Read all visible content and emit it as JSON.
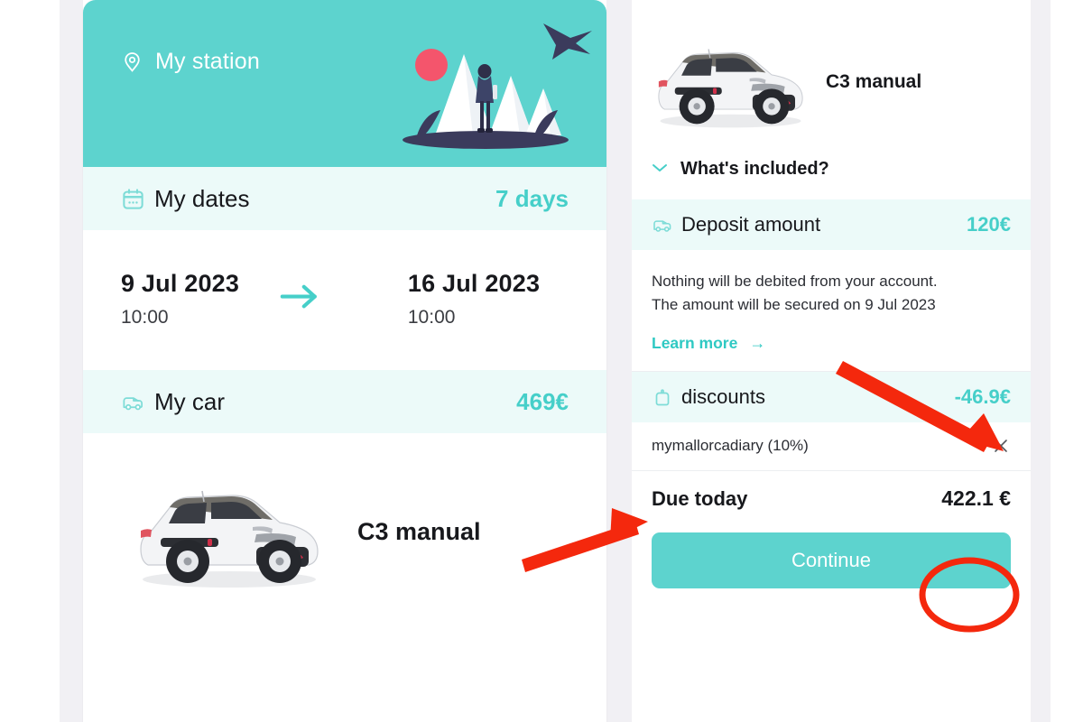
{
  "colors": {
    "teal": "#5dd3ce",
    "teal_text": "#46cfc9",
    "teal_light_bg": "#ecfaf9",
    "dark_text": "#17181c",
    "annotation_red": "#f4280d",
    "page_bg": "#f1f0f4"
  },
  "left_panel": {
    "station": {
      "icon": "location-pin-icon",
      "label": "My station"
    },
    "dates_strip": {
      "icon": "calendar-icon",
      "label": "My dates",
      "value": "7 days"
    },
    "dates": {
      "pickup_date": "9 Jul 2023",
      "pickup_time": "10:00",
      "arrow_icon": "arrow-right-icon",
      "dropoff_date": "16 Jul 2023",
      "dropoff_time": "10:00"
    },
    "car_strip": {
      "icon": "car-icon",
      "label": "My car",
      "value": "469€"
    },
    "car": {
      "image": "white-citroen-c3-photo",
      "name": "C3 manual"
    }
  },
  "right_panel": {
    "car": {
      "image": "white-citroen-c3-photo",
      "name": "C3 manual"
    },
    "whats_included": {
      "chevron_icon": "chevron-down-icon",
      "label": "What's included?"
    },
    "deposit": {
      "icon": "car-icon",
      "label": "Deposit amount",
      "value": "120€",
      "note_line_1": "Nothing will be debited from your account.",
      "note_line_2": "The amount will be secured on 9 Jul 2023",
      "learn_more": "Learn more",
      "learn_more_arrow": "→"
    },
    "discounts": {
      "icon": "tag-icon",
      "label": "discounts",
      "value": "-46.9€",
      "applied": [
        {
          "code": "mymallorcadiary (10%)",
          "remove_icon": "close-x-icon"
        }
      ]
    },
    "due_today": {
      "label": "Due today",
      "value": "422.1 €"
    },
    "continue_button": "Continue"
  },
  "annotations": [
    {
      "type": "arrow",
      "name": "arrow-pointing-to-discount-amount"
    },
    {
      "type": "arrow",
      "name": "arrow-pointing-to-discount-code"
    },
    {
      "type": "ellipse",
      "name": "ellipse-around-due-today-amount"
    }
  ]
}
